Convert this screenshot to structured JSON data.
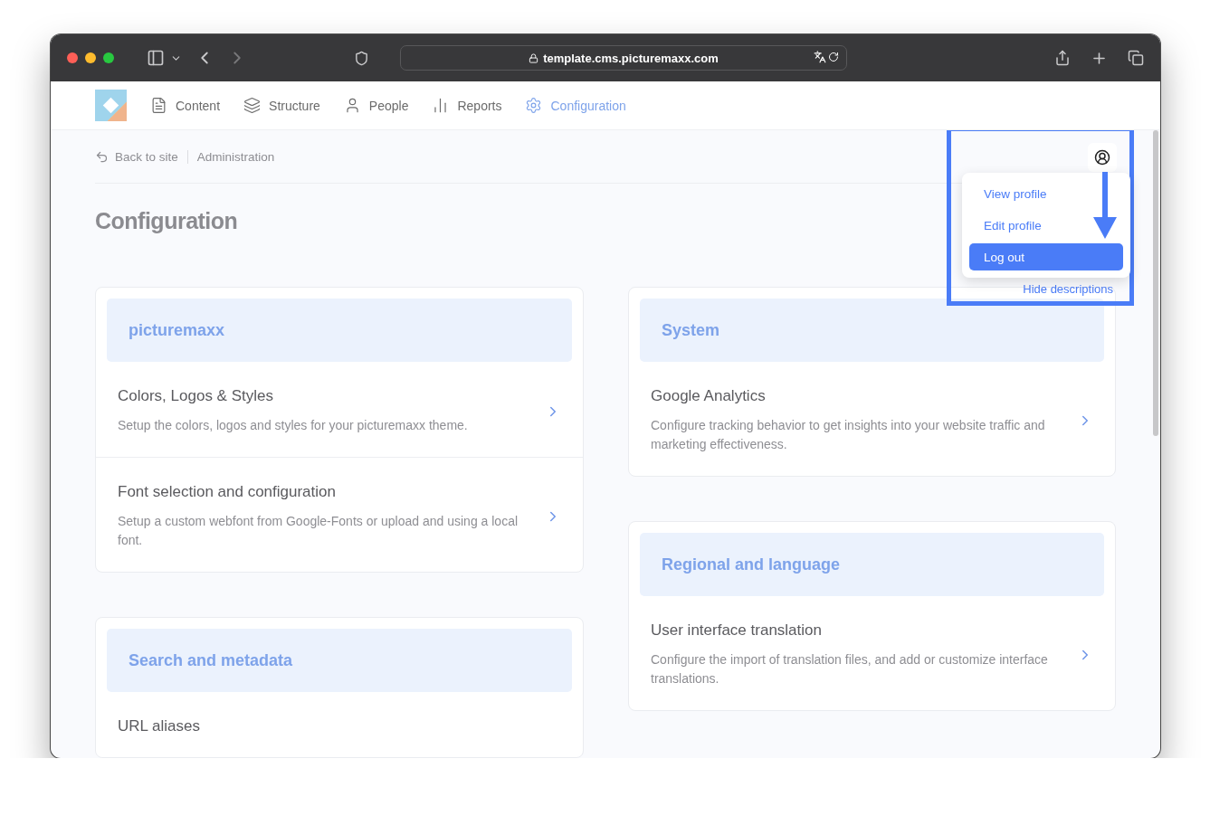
{
  "browser": {
    "url": "template.cms.picturemaxx.com"
  },
  "nav": {
    "items": [
      {
        "label": "Content",
        "selected": false
      },
      {
        "label": "Structure",
        "selected": false
      },
      {
        "label": "People",
        "selected": false
      },
      {
        "label": "Reports",
        "selected": false
      },
      {
        "label": "Configuration",
        "selected": true
      }
    ]
  },
  "breadcrumb": {
    "back": "Back to site",
    "current": "Administration"
  },
  "title": "Configuration",
  "user_menu": {
    "items": [
      {
        "label": "View profile",
        "selected": false
      },
      {
        "label": "Edit profile",
        "selected": false
      },
      {
        "label": "Log out",
        "selected": true
      }
    ]
  },
  "hide_link": "Hide descriptions",
  "columns": [
    [
      {
        "title": "picturemaxx",
        "items": [
          {
            "title": "Colors, Logos & Styles",
            "description": "Setup the colors, logos and styles for your picturemaxx theme."
          },
          {
            "title": "Font selection and configuration",
            "description": "Setup a custom webfont from Google-Fonts or upload and using a local font."
          }
        ]
      },
      {
        "title": "Search and metadata",
        "items": [
          {
            "title": "URL aliases"
          }
        ]
      }
    ],
    [
      {
        "title": "System",
        "items": [
          {
            "title": "Google Analytics",
            "description": "Configure tracking behavior to get insights into your website traffic and marketing effectiveness."
          }
        ]
      },
      {
        "title": "Regional and language",
        "items": [
          {
            "title": "User interface translation",
            "description": "Configure the import of translation files, and add or customize interface translations."
          }
        ]
      }
    ]
  ]
}
